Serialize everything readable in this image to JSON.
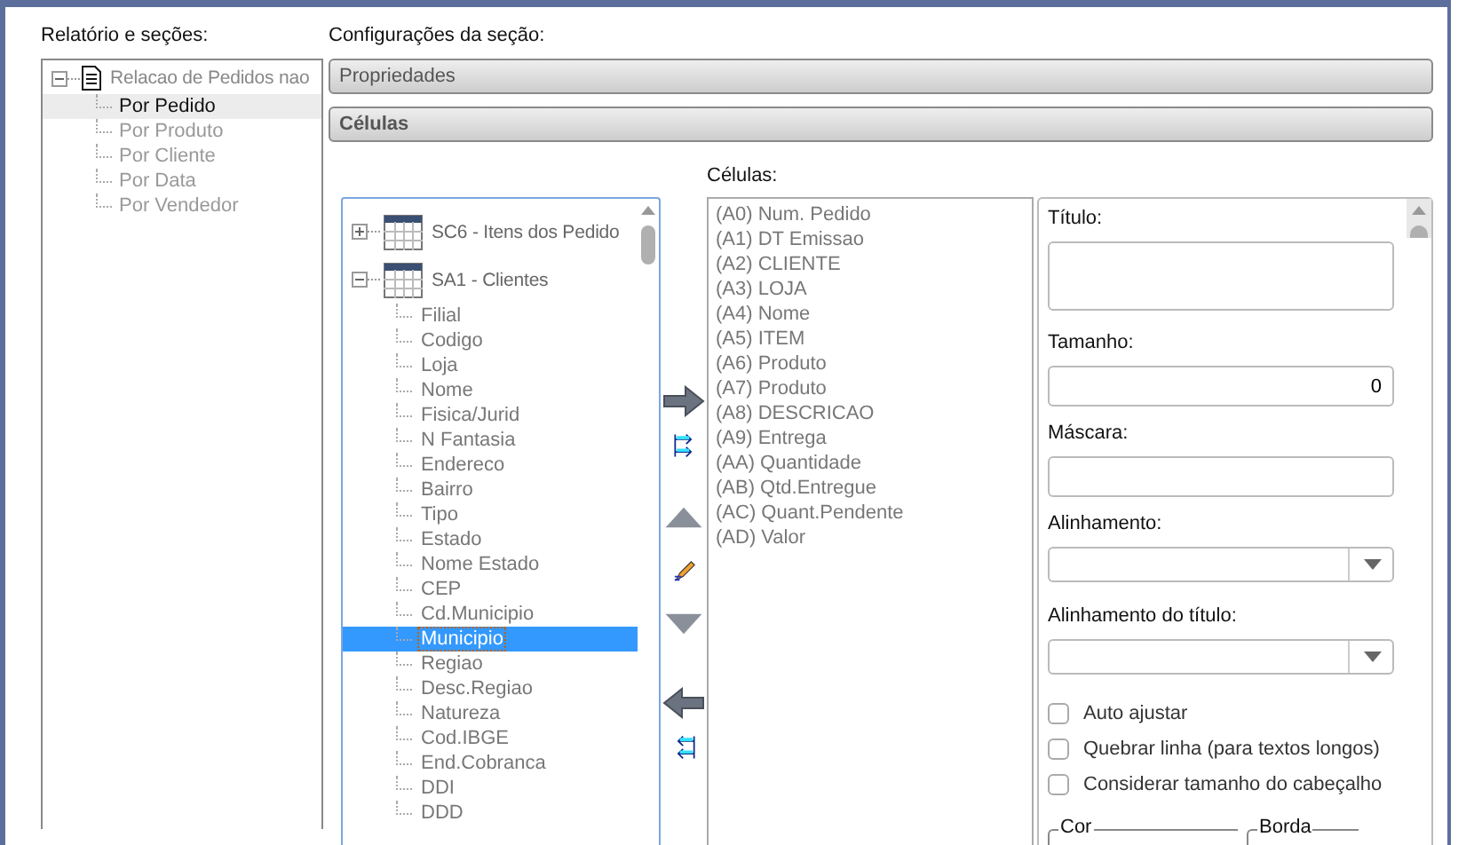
{
  "sidebar": {
    "label": "Relatório e seções:",
    "tree": [
      {
        "label": "Relacao de Pedidos nao",
        "expanded": true,
        "children": [
          {
            "label": "Por Pedido",
            "selected": true
          },
          {
            "label": "Por Produto",
            "selected": false
          },
          {
            "label": "Por Cliente",
            "selected": false
          },
          {
            "label": "Por Data",
            "selected": false
          },
          {
            "label": "Por Vendedor",
            "selected": false
          }
        ]
      }
    ]
  },
  "section_settings": {
    "label": "Configurações da seção:",
    "panels": [
      {
        "label": "Propriedades",
        "expanded": false
      },
      {
        "label": "Células",
        "expanded": true
      }
    ]
  },
  "fields_tree": [
    {
      "label": "SC6 - Itens dos Pedido",
      "expanded": false
    },
    {
      "label": "SA1 - Clientes",
      "expanded": true,
      "children": [
        {
          "label": "Filial",
          "selected": false
        },
        {
          "label": "Codigo",
          "selected": false
        },
        {
          "label": "Loja",
          "selected": false
        },
        {
          "label": "Nome",
          "selected": false
        },
        {
          "label": "Fisica/Jurid",
          "selected": false
        },
        {
          "label": "N Fantasia",
          "selected": false
        },
        {
          "label": "Endereco",
          "selected": false
        },
        {
          "label": "Bairro",
          "selected": false
        },
        {
          "label": "Tipo",
          "selected": false
        },
        {
          "label": "Estado",
          "selected": false
        },
        {
          "label": "Nome Estado",
          "selected": false
        },
        {
          "label": "CEP",
          "selected": false
        },
        {
          "label": "Cd.Municipio",
          "selected": false
        },
        {
          "label": "Municipio",
          "selected": true
        },
        {
          "label": "Regiao",
          "selected": false
        },
        {
          "label": "Desc.Regiao",
          "selected": false
        },
        {
          "label": "Natureza",
          "selected": false
        },
        {
          "label": "Cod.IBGE",
          "selected": false
        },
        {
          "label": "End.Cobranca",
          "selected": false
        },
        {
          "label": "DDI",
          "selected": false
        },
        {
          "label": "DDD",
          "selected": false
        }
      ]
    }
  ],
  "cells": {
    "label": "Células:",
    "items": [
      "(A0) Num. Pedido",
      "(A1) DT Emissao",
      "(A2) CLIENTE",
      "(A3) LOJA",
      "(A4) Nome",
      "(A5) ITEM",
      "(A6) Produto",
      "(A7) Produto",
      "(A8) DESCRICAO",
      "(A9) Entrega",
      "(AA) Quantidade",
      "(AB) Qtd.Entregue",
      "(AC) Quant.Pendente",
      "(AD) Valor"
    ]
  },
  "properties": {
    "fields": [
      {
        "kind": "textarea",
        "label": "Título:"
      },
      {
        "kind": "text",
        "label": "Tamanho:",
        "value": "0"
      },
      {
        "kind": "text",
        "label": "Máscara:"
      },
      {
        "kind": "select",
        "label": "Alinhamento:"
      },
      {
        "kind": "select",
        "label": "Alinhamento do título:"
      }
    ],
    "checkboxes": [
      {
        "label": "Auto ajustar",
        "checked": false
      },
      {
        "label": "Quebrar linha (para textos longos)",
        "checked": false
      },
      {
        "label": "Considerar tamanho do cabeçalho",
        "checked": false
      }
    ],
    "groups": [
      "Cor",
      "Borda"
    ]
  }
}
